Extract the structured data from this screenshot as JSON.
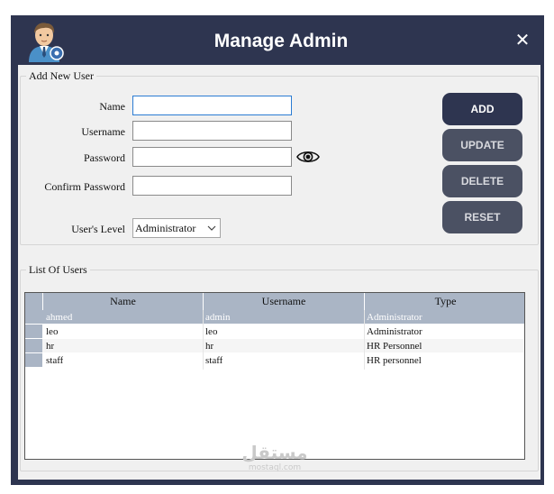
{
  "window": {
    "title": "Manage Admin",
    "close_glyph": "✕"
  },
  "add_user": {
    "legend": "Add New User",
    "name_label": "Name",
    "name_value": "",
    "username_label": "Username",
    "username_value": "",
    "password_label": "Password",
    "password_value": "",
    "confirm_label": "Confirm Password",
    "confirm_value": "",
    "level_label": "User's Level",
    "level_value": "Administrator"
  },
  "buttons": {
    "add": "ADD",
    "update": "UPDATE",
    "delete": "DELETE",
    "reset": "RESET"
  },
  "users": {
    "legend": "List Of Users",
    "columns": [
      "Name",
      "Username",
      "Type"
    ],
    "rows": [
      [
        "ahmed",
        "admin",
        "Administrator"
      ],
      [
        "leo",
        "leo",
        "Administrator"
      ],
      [
        "hr",
        "hr",
        "HR Personnel"
      ],
      [
        "staff",
        "staff",
        "HR personnel"
      ]
    ],
    "selected_row": 0
  },
  "watermark": {
    "arabic": "مستقل",
    "latin": "mostaql.com"
  },
  "icons": {
    "avatar": "admin-avatar-icon",
    "eye": "eye-icon",
    "close": "close-icon",
    "caret": "chevron-down-icon"
  },
  "colors": {
    "titlebar": "#2e3550",
    "primary_button": "#2e3550",
    "secondary_button": "#4b5163",
    "grid_header": "#aab5c5",
    "focus_border": "#2b7cd3"
  }
}
